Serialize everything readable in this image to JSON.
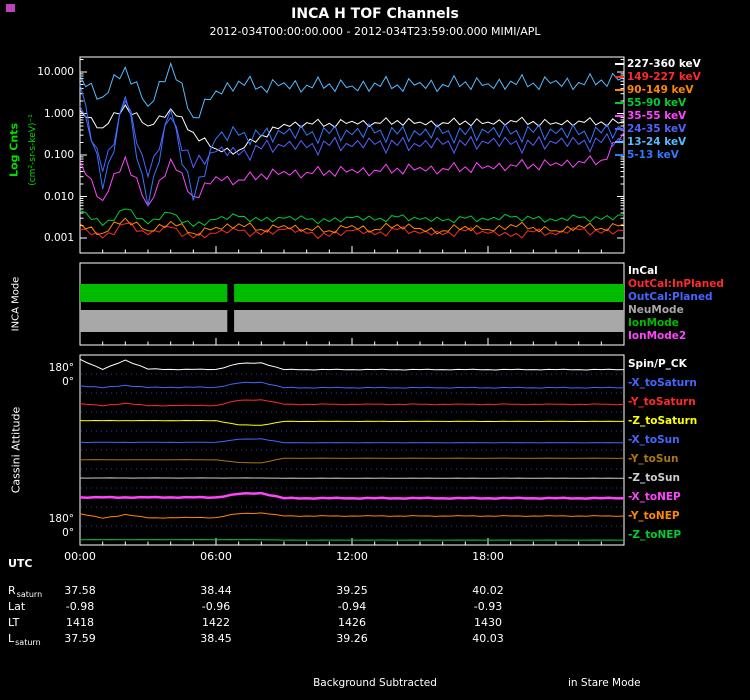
{
  "header": {
    "title": "INCA H TOF Channels",
    "subtitle": "2012-034T00:00:00.000 - 2012-034T23:59:00.000 MIMI/APL"
  },
  "footer": {
    "center_note": "Background Subtracted",
    "right_note": "in Stare Mode"
  },
  "xaxis": {
    "label": "UTC",
    "ticks": [
      "00:00",
      "06:00",
      "12:00",
      "18:00"
    ],
    "xlim_hours": [
      0,
      24
    ]
  },
  "ephemeris": {
    "rows": [
      {
        "label": "R",
        "sub": "saturn",
        "values": [
          "37.58",
          "38.44",
          "39.25",
          "40.02"
        ]
      },
      {
        "label": "Lat",
        "sub": "",
        "values": [
          "-0.98",
          "-0.96",
          "-0.94",
          "-0.93"
        ]
      },
      {
        "label": "LT",
        "sub": "",
        "values": [
          "1418",
          "1422",
          "1426",
          "1430"
        ]
      },
      {
        "label": "L",
        "sub": "saturn",
        "values": [
          "37.59",
          "38.45",
          "39.26",
          "40.03"
        ]
      }
    ]
  },
  "chart_data": [
    {
      "type": "line",
      "name": "counts-panel",
      "ylabel": "Log Cnts",
      "ylabel_units": "(cm²-sr-s-keV)⁻¹",
      "yscale": "log",
      "ylim": [
        0.0005,
        23
      ],
      "yticks": [
        "10.000",
        "1.000",
        "0.100",
        "0.010",
        "0.001"
      ],
      "legend_position": "right",
      "x_hours": [
        0,
        1,
        2,
        3,
        4,
        5,
        6,
        7,
        8,
        9,
        10,
        11,
        12,
        13,
        14,
        15,
        16,
        17,
        18,
        19,
        20,
        21,
        22,
        23,
        24
      ],
      "series": [
        {
          "name": "227-360 keV",
          "color": "#ffffff",
          "noise": 0.12,
          "values": [
            1.2,
            0.45,
            1.6,
            0.5,
            1.3,
            0.35,
            0.14,
            0.13,
            0.3,
            0.55,
            0.6,
            0.58,
            0.65,
            0.6,
            0.68,
            0.62,
            0.6,
            0.66,
            0.62,
            0.68,
            0.64,
            0.6,
            0.66,
            0.63,
            0.65
          ]
        },
        {
          "name": "149-227 keV",
          "color": "#ff2a2a",
          "noise": 0.1,
          "values": [
            0.0016,
            0.001,
            0.0022,
            0.0012,
            0.0018,
            0.001,
            0.0013,
            0.0015,
            0.0012,
            0.0016,
            0.0013,
            0.0011,
            0.0015,
            0.0012,
            0.0016,
            0.0013,
            0.0012,
            0.0015,
            0.0013,
            0.0011,
            0.0014,
            0.0012,
            0.0016,
            0.0013,
            0.0015
          ]
        },
        {
          "name": "90-149 keV",
          "color": "#ff8800",
          "noise": 0.1,
          "values": [
            0.0022,
            0.0013,
            0.003,
            0.0015,
            0.0025,
            0.0013,
            0.0018,
            0.0022,
            0.0016,
            0.002,
            0.0017,
            0.0015,
            0.002,
            0.0016,
            0.0021,
            0.0017,
            0.0015,
            0.0019,
            0.0016,
            0.0021,
            0.0018,
            0.0015,
            0.002,
            0.0017,
            0.0022
          ]
        },
        {
          "name": "55-90 keV",
          "color": "#00cc33",
          "noise": 0.09,
          "values": [
            0.0045,
            0.002,
            0.005,
            0.0022,
            0.004,
            0.0019,
            0.0028,
            0.0033,
            0.0026,
            0.003,
            0.0028,
            0.0025,
            0.0031,
            0.0027,
            0.0032,
            0.0028,
            0.0026,
            0.003,
            0.0027,
            0.0032,
            0.0029,
            0.0026,
            0.0031,
            0.0028,
            0.0035
          ]
        },
        {
          "name": "35-55 keV",
          "color": "#ff44ff",
          "noise": 0.16,
          "values": [
            0.07,
            0.008,
            0.09,
            0.006,
            0.08,
            0.01,
            0.03,
            0.025,
            0.035,
            0.04,
            0.038,
            0.042,
            0.045,
            0.043,
            0.048,
            0.05,
            0.047,
            0.052,
            0.055,
            0.058,
            0.06,
            0.065,
            0.07,
            0.075,
            0.35
          ]
        },
        {
          "name": "24-35 keV",
          "color": "#5560ff",
          "noise": 0.22,
          "values": [
            1.5,
            0.04,
            2.0,
            0.03,
            0.8,
            0.05,
            0.12,
            0.1,
            0.14,
            0.16,
            0.15,
            0.17,
            0.16,
            0.18,
            0.17,
            0.16,
            0.18,
            0.17,
            0.19,
            0.18,
            0.17,
            0.19,
            0.18,
            0.2,
            0.22
          ]
        },
        {
          "name": "13-24 keV",
          "color": "#55bbff",
          "noise": 0.2,
          "values": [
            8,
            2.5,
            13,
            1.5,
            16,
            0.8,
            3.5,
            6,
            4.5,
            5.5,
            4.8,
            5.2,
            4.6,
            5.4,
            4.9,
            5.6,
            5.0,
            5.8,
            5.2,
            6.0,
            5.4,
            6.2,
            5.6,
            6.4,
            7.5
          ]
        },
        {
          "name": "5-13 keV",
          "color": "#3377ff",
          "noise": 0.25,
          "values": [
            5,
            0.015,
            2.5,
            0.006,
            1.2,
            0.008,
            0.25,
            0.3,
            0.28,
            0.32,
            0.3,
            0.33,
            0.31,
            0.34,
            0.32,
            0.3,
            0.33,
            0.31,
            0.34,
            0.32,
            0.35,
            0.33,
            0.31,
            0.34,
            0.4
          ]
        }
      ]
    },
    {
      "type": "timeline",
      "name": "mode-panel",
      "ylabel": "INCA Mode",
      "legend": [
        {
          "label": "InCal",
          "color": "#ffffff"
        },
        {
          "label": "OutCal:InPlaned",
          "color": "#ff2a2a"
        },
        {
          "label": "OutCal:Planed",
          "color": "#4466ff"
        },
        {
          "label": "NeuMode",
          "color": "#a8a8a8"
        },
        {
          "label": "IonMode",
          "color": "#00bb00"
        },
        {
          "label": "IonMode2",
          "color": "#ff44ff"
        }
      ],
      "bars": [
        {
          "name": "IonMode",
          "color": "#00bb00",
          "lane": 0,
          "segments": [
            [
              0,
              6.5
            ],
            [
              6.8,
              24
            ]
          ]
        },
        {
          "name": "NeuMode",
          "color": "#a8a8a8",
          "lane": 1,
          "segments": [
            [
              0,
              6.5
            ],
            [
              6.8,
              24
            ]
          ]
        }
      ]
    },
    {
      "type": "line",
      "name": "attitude-panel",
      "ylabel": "Cassini Attitude",
      "band_ylim_deg": [
        0,
        180
      ],
      "yticks": [
        "180°",
        "0°",
        "180°",
        "0°"
      ],
      "x_hours": [
        0,
        1,
        2,
        3,
        4,
        5,
        6,
        7,
        8,
        9,
        10,
        11,
        12,
        13,
        14,
        15,
        16,
        17,
        18,
        19,
        20,
        21,
        22,
        23,
        24
      ],
      "series": [
        {
          "name": "Spin/P_CK",
          "color": "#ffffff",
          "noise": 4,
          "values": [
            150,
            20,
            140,
            25,
            20,
            20,
            20,
            95,
            105,
            18,
            18,
            18,
            18,
            18,
            18,
            18,
            18,
            18,
            18,
            18,
            18,
            18,
            18,
            18,
            18
          ]
        },
        {
          "name": "-X_toSaturn",
          "color": "#4466ff",
          "noise": 3,
          "values": [
            55,
            30,
            60,
            32,
            35,
            35,
            35,
            90,
            100,
            30,
            30,
            30,
            30,
            30,
            30,
            30,
            30,
            30,
            30,
            30,
            30,
            30,
            30,
            30,
            30
          ]
        },
        {
          "name": "-Y_toSaturn",
          "color": "#ff2a2a",
          "noise": 3,
          "values": [
            70,
            40,
            75,
            42,
            45,
            45,
            45,
            110,
            120,
            60,
            60,
            60,
            60,
            60,
            60,
            60,
            60,
            60,
            60,
            60,
            60,
            60,
            60,
            60,
            60
          ]
        },
        {
          "name": "-Z_toSaturn",
          "color": "#ffff00",
          "noise": 1.5,
          "values": [
            95,
            95,
            95,
            95,
            95,
            95,
            95,
            40,
            35,
            85,
            85,
            85,
            85,
            85,
            85,
            85,
            85,
            85,
            85,
            85,
            85,
            85,
            85,
            85,
            85
          ]
        },
        {
          "name": "-X_toSun",
          "color": "#4466ff",
          "noise": 1,
          "values": [
            60,
            60,
            60,
            60,
            60,
            60,
            60,
            100,
            105,
            55,
            55,
            55,
            55,
            55,
            55,
            55,
            55,
            55,
            55,
            55,
            55,
            55,
            55,
            55,
            55
          ]
        },
        {
          "name": "-Y_toSun",
          "color": "#aa7711",
          "noise": 1,
          "values": [
            80,
            80,
            80,
            80,
            80,
            80,
            80,
            45,
            40,
            100,
            100,
            100,
            100,
            100,
            100,
            100,
            100,
            100,
            100,
            100,
            100,
            100,
            100,
            100,
            100
          ]
        },
        {
          "name": "-Z_toSun",
          "color": "#cccccc",
          "noise": 0.8,
          "values": [
            90,
            90,
            90,
            90,
            90,
            90,
            90,
            90,
            90,
            88,
            88,
            88,
            88,
            88,
            88,
            88,
            88,
            88,
            88,
            88,
            88,
            88,
            88,
            88,
            88
          ]
        },
        {
          "name": "-X_toNEP",
          "color": "#ff44ff",
          "noise": 3,
          "thick": true,
          "values": [
            85,
            85,
            85,
            85,
            85,
            85,
            85,
            130,
            140,
            75,
            75,
            75,
            75,
            75,
            75,
            75,
            75,
            75,
            75,
            75,
            75,
            75,
            75,
            75,
            75
          ]
        },
        {
          "name": "-Y_toNEP",
          "color": "#ff8800",
          "noise": 3,
          "values": [
            120,
            60,
            110,
            65,
            70,
            70,
            70,
            120,
            130,
            90,
            90,
            90,
            90,
            90,
            90,
            90,
            90,
            90,
            90,
            90,
            90,
            90,
            90,
            90,
            90
          ]
        },
        {
          "name": "-Z_toNEP",
          "color": "#00cc33",
          "noise": 0.8,
          "values": [
            30,
            30,
            30,
            30,
            30,
            30,
            30,
            30,
            30,
            25,
            25,
            25,
            25,
            25,
            25,
            25,
            25,
            25,
            25,
            25,
            25,
            25,
            25,
            25,
            25
          ]
        }
      ]
    }
  ]
}
